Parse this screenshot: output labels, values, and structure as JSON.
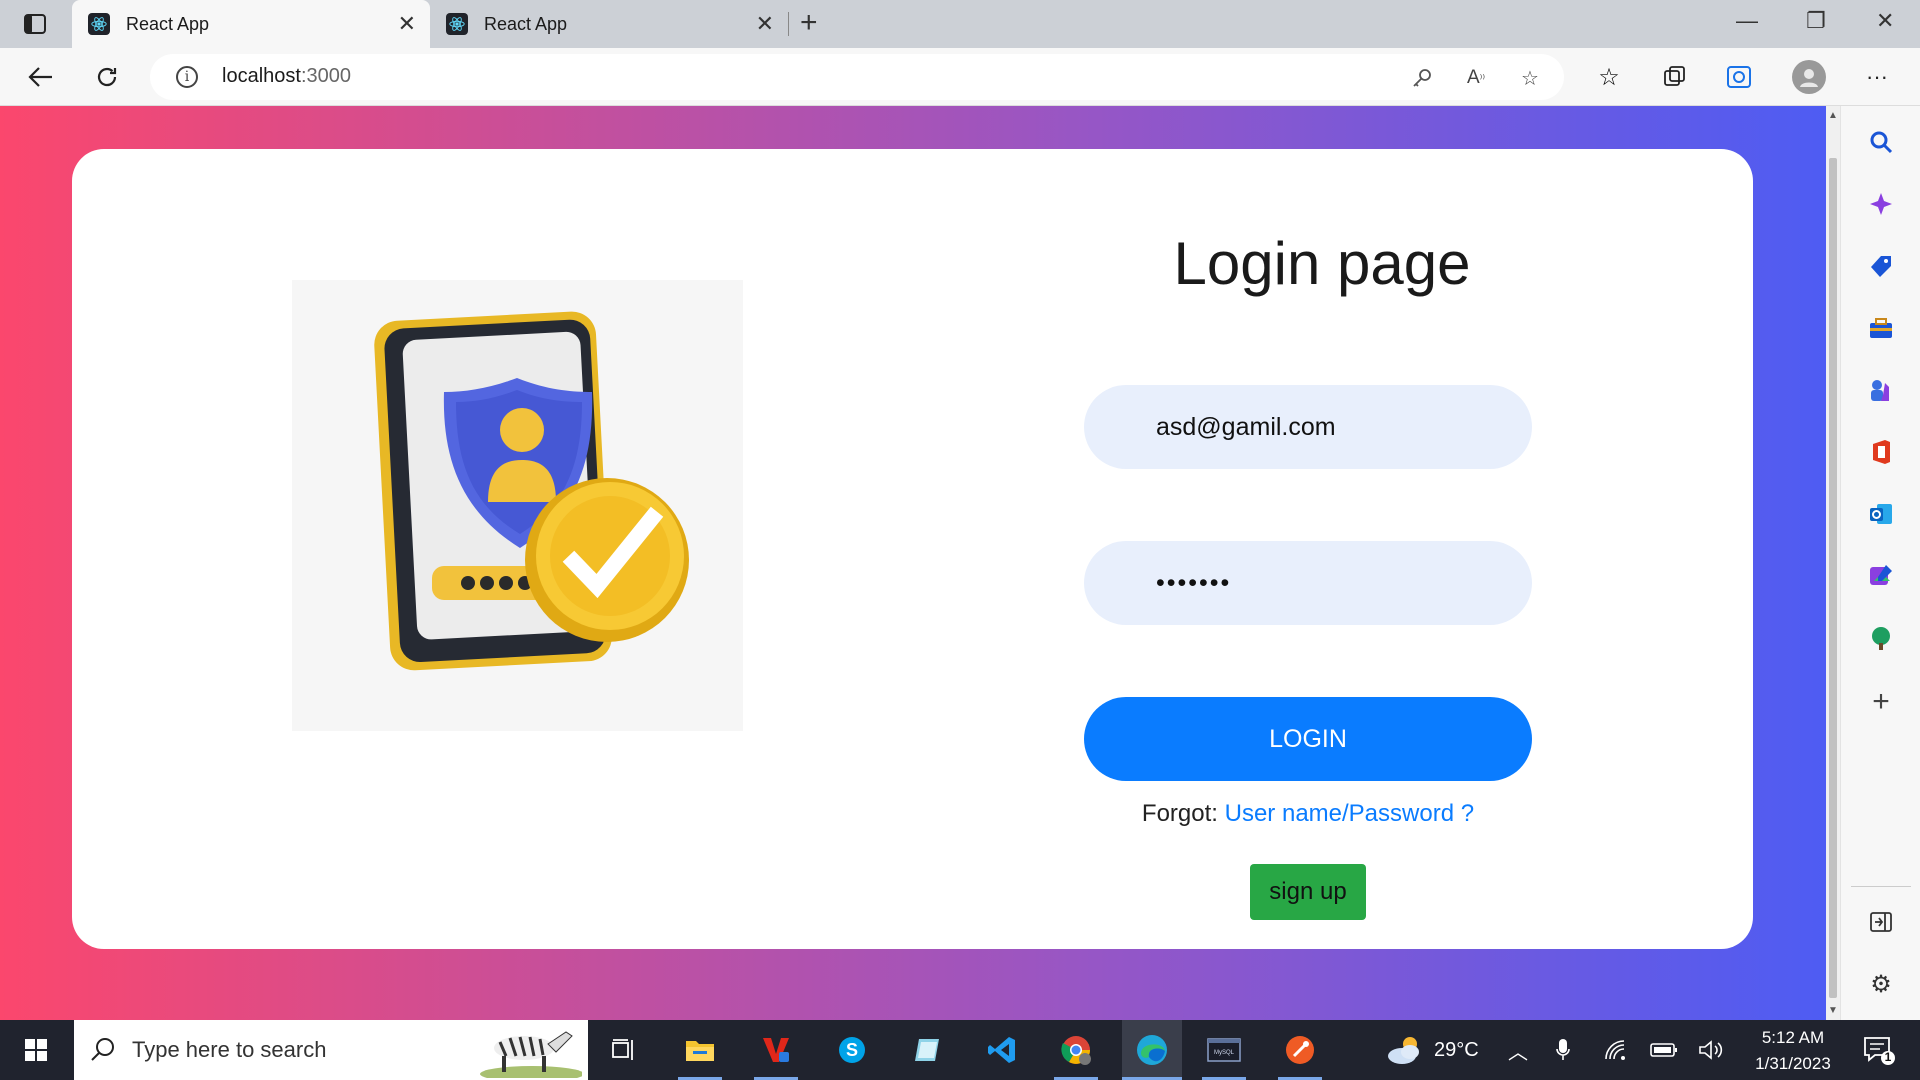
{
  "browser": {
    "tabs": [
      {
        "title": "React App",
        "active": true
      },
      {
        "title": "React App",
        "active": false
      }
    ],
    "url_host": "localhost",
    "url_port": ":3000"
  },
  "page": {
    "title": "Login page",
    "email_value": "asd@gamil.com",
    "password_value": "•••••••",
    "login_label": "LOGIN",
    "forgot_prefix": "Forgot: ",
    "forgot_link": "User name/Password ?",
    "signup_label": "sign up"
  },
  "taskbar": {
    "search_placeholder": "Type here to search",
    "temperature": "29°C",
    "time": "5:12 AM",
    "date": "1/31/2023",
    "notification_count": "1"
  },
  "colors": {
    "gradient_start": "#fb476d",
    "gradient_end": "#4e5cf3",
    "primary": "#0a7cff",
    "success": "#28a745",
    "input_bg": "#e8effc"
  }
}
